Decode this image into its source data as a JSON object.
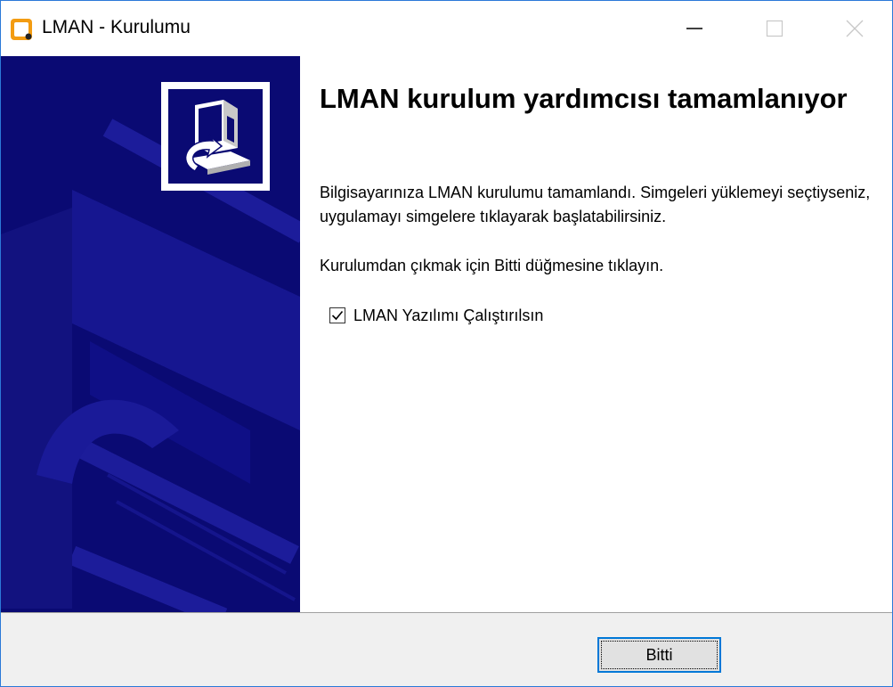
{
  "window": {
    "title": "LMAN - Kurulumu",
    "icon": "app-icon",
    "controls": [
      "minimize-icon",
      "maximize-icon",
      "close-icon"
    ]
  },
  "banner": {
    "logo_icon": "installer-computer-icon",
    "background_color": "#0a0a73"
  },
  "content": {
    "heading": "LMAN kurulum yardımcısı tamamlanıyor",
    "paragraph1": "Bilgisayarınıza LMAN kurulumu tamamlandı. Simgeleri yüklemeyi seçtiyseniz, uygulamayı simgelere tıklayarak başlatabilirsiniz.",
    "paragraph2": "Kurulumdan çıkmak için Bitti düğmesine tıklayın.",
    "checkbox": {
      "label": "LMAN Yazılımı Çalıştırılsın",
      "checked": true
    }
  },
  "footer": {
    "finish_label": "Bitti"
  },
  "colors": {
    "accent": "#0078d7",
    "app_icon_orange": "#f39c12",
    "banner": "#0a0a73"
  }
}
